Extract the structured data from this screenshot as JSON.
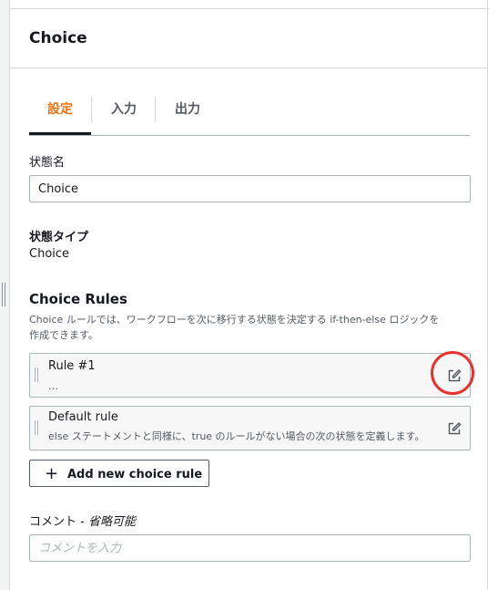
{
  "panel": {
    "title": "Choice",
    "tabs": [
      {
        "label": "設定",
        "active": true
      },
      {
        "label": "入力",
        "active": false
      },
      {
        "label": "出力",
        "active": false
      }
    ]
  },
  "state_name": {
    "label": "状態名",
    "value": "Choice"
  },
  "state_type": {
    "label": "状態タイプ",
    "value": "Choice"
  },
  "choice_rules": {
    "title": "Choice Rules",
    "description_line1": "Choice ルールでは、ワークフローを次に移行する状態を決定する if-then-else ロジックを",
    "description_line2": "作成できます。",
    "rules": [
      {
        "name": "Rule #1",
        "summary": "…"
      },
      {
        "name": "Default rule",
        "summary": "else ステートメントと同様に、true のルールがない場合の次の状態を定義します。"
      }
    ],
    "add_button_label": "Add new choice rule"
  },
  "comment": {
    "label": "コメント - ",
    "optional": "省略可能",
    "placeholder": "コメントを入力"
  },
  "colors": {
    "accent": "#ec7211",
    "highlight": "#e8322d"
  },
  "icons": {
    "edit": "edit-icon",
    "add": "plus-icon",
    "drag": "drag-handle-icon"
  }
}
